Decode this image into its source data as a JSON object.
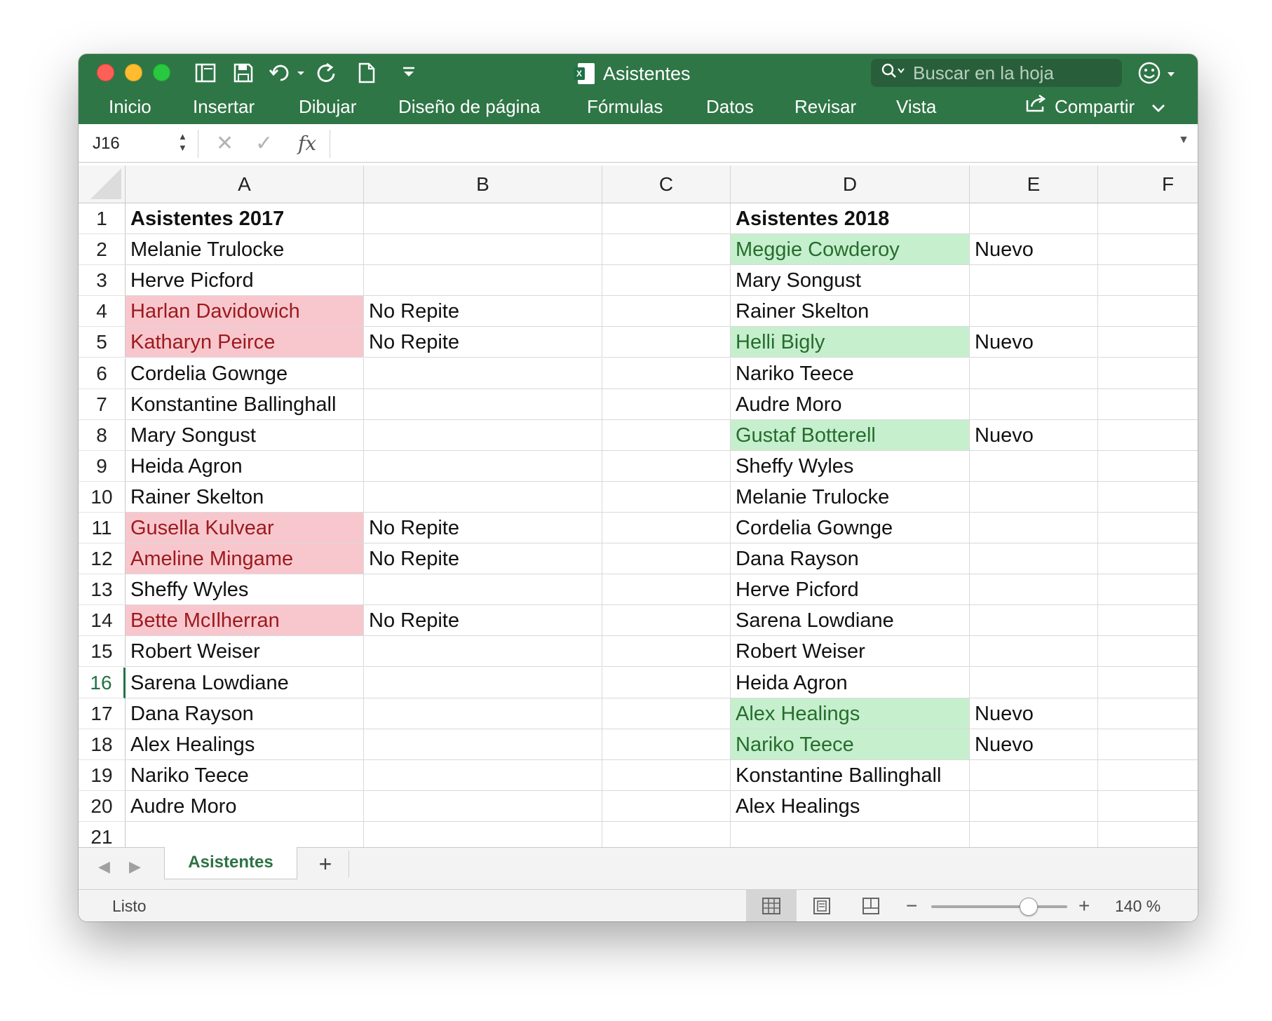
{
  "window": {
    "title": "Asistentes"
  },
  "search": {
    "placeholder": "Buscar en la hoja"
  },
  "ribbon": {
    "tabs": [
      "Inicio",
      "Insertar",
      "Dibujar",
      "Diseño de página",
      "Fórmulas",
      "Datos",
      "Revisar",
      "Vista"
    ],
    "share_label": "Compartir"
  },
  "formula_bar": {
    "cell_ref": "J16",
    "formula": ""
  },
  "grid": {
    "columns": [
      "A",
      "B",
      "C",
      "D",
      "E",
      "F"
    ],
    "rows": [
      "1",
      "2",
      "3",
      "4",
      "5",
      "6",
      "7",
      "8",
      "9",
      "10",
      "11",
      "12",
      "13",
      "14",
      "15",
      "16",
      "17",
      "18",
      "19",
      "20",
      "21"
    ],
    "active_row": "16",
    "styles": {
      "red_fill": "#f8c7ce",
      "red_text": "#9c1a1d",
      "green_fill": "#c6efce",
      "green_text": "#266d2d"
    },
    "cells": [
      {
        "col": "A",
        "row": "1",
        "value": "Asistentes 2017",
        "bold": true
      },
      {
        "col": "A",
        "row": "2",
        "value": "Melanie Trulocke"
      },
      {
        "col": "A",
        "row": "3",
        "value": "Herve Picford"
      },
      {
        "col": "A",
        "row": "4",
        "value": "Harlan Davidowich",
        "fill": "red"
      },
      {
        "col": "A",
        "row": "5",
        "value": "Katharyn Peirce",
        "fill": "red"
      },
      {
        "col": "A",
        "row": "6",
        "value": "Cordelia Gownge"
      },
      {
        "col": "A",
        "row": "7",
        "value": "Konstantine Ballinghall"
      },
      {
        "col": "A",
        "row": "8",
        "value": "Mary Songust"
      },
      {
        "col": "A",
        "row": "9",
        "value": "Heida Agron"
      },
      {
        "col": "A",
        "row": "10",
        "value": "Rainer Skelton"
      },
      {
        "col": "A",
        "row": "11",
        "value": "Gusella Kulvear",
        "fill": "red"
      },
      {
        "col": "A",
        "row": "12",
        "value": "Ameline Mingame",
        "fill": "red"
      },
      {
        "col": "A",
        "row": "13",
        "value": "Sheffy Wyles"
      },
      {
        "col": "A",
        "row": "14",
        "value": "Bette McIlherran",
        "fill": "red"
      },
      {
        "col": "A",
        "row": "15",
        "value": "Robert Weiser"
      },
      {
        "col": "A",
        "row": "16",
        "value": "Sarena Lowdiane"
      },
      {
        "col": "A",
        "row": "17",
        "value": "Dana Rayson"
      },
      {
        "col": "A",
        "row": "18",
        "value": "Alex Healings"
      },
      {
        "col": "A",
        "row": "19",
        "value": "Nariko Teece"
      },
      {
        "col": "A",
        "row": "20",
        "value": "Audre Moro"
      },
      {
        "col": "B",
        "row": "4",
        "value": "No Repite"
      },
      {
        "col": "B",
        "row": "5",
        "value": "No Repite"
      },
      {
        "col": "B",
        "row": "11",
        "value": "No Repite"
      },
      {
        "col": "B",
        "row": "12",
        "value": "No Repite"
      },
      {
        "col": "B",
        "row": "14",
        "value": "No Repite"
      },
      {
        "col": "D",
        "row": "1",
        "value": "Asistentes 2018",
        "bold": true
      },
      {
        "col": "D",
        "row": "2",
        "value": "Meggie Cowderoy",
        "fill": "green"
      },
      {
        "col": "D",
        "row": "3",
        "value": "Mary Songust"
      },
      {
        "col": "D",
        "row": "4",
        "value": "Rainer Skelton"
      },
      {
        "col": "D",
        "row": "5",
        "value": "Helli Bigly",
        "fill": "green"
      },
      {
        "col": "D",
        "row": "6",
        "value": "Nariko Teece"
      },
      {
        "col": "D",
        "row": "7",
        "value": "Audre Moro"
      },
      {
        "col": "D",
        "row": "8",
        "value": "Gustaf Botterell",
        "fill": "green"
      },
      {
        "col": "D",
        "row": "9",
        "value": "Sheffy Wyles"
      },
      {
        "col": "D",
        "row": "10",
        "value": "Melanie Trulocke"
      },
      {
        "col": "D",
        "row": "11",
        "value": "Cordelia Gownge"
      },
      {
        "col": "D",
        "row": "12",
        "value": "Dana Rayson"
      },
      {
        "col": "D",
        "row": "13",
        "value": "Herve Picford"
      },
      {
        "col": "D",
        "row": "14",
        "value": "Sarena Lowdiane"
      },
      {
        "col": "D",
        "row": "15",
        "value": "Robert Weiser"
      },
      {
        "col": "D",
        "row": "16",
        "value": "Heida Agron"
      },
      {
        "col": "D",
        "row": "17",
        "value": "Alex Healings",
        "fill": "green"
      },
      {
        "col": "D",
        "row": "18",
        "value": "Nariko Teece",
        "fill": "green"
      },
      {
        "col": "D",
        "row": "19",
        "value": "Konstantine Ballinghall"
      },
      {
        "col": "D",
        "row": "20",
        "value": "Alex Healings"
      },
      {
        "col": "E",
        "row": "2",
        "value": "Nuevo"
      },
      {
        "col": "E",
        "row": "5",
        "value": "Nuevo"
      },
      {
        "col": "E",
        "row": "8",
        "value": "Nuevo"
      },
      {
        "col": "E",
        "row": "17",
        "value": "Nuevo"
      },
      {
        "col": "E",
        "row": "18",
        "value": "Nuevo"
      }
    ]
  },
  "sheets": {
    "active": "Asistentes"
  },
  "status": {
    "text": "Listo",
    "zoom": "140 %",
    "zoom_level": 140
  }
}
